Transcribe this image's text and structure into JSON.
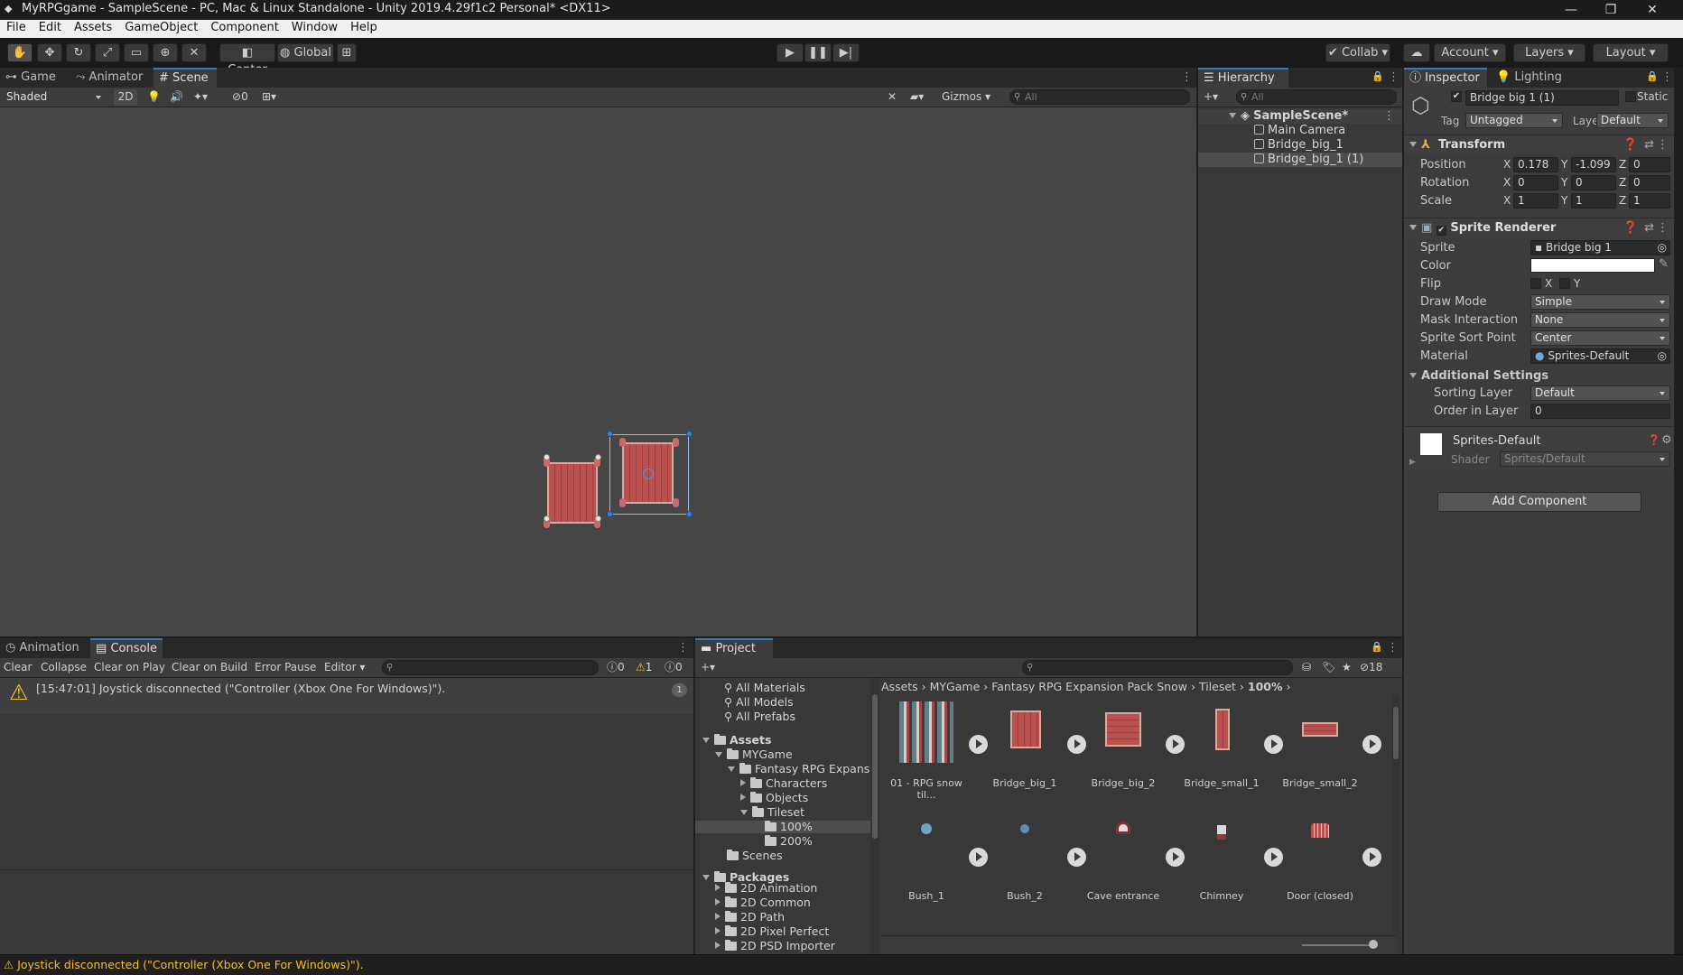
{
  "window": {
    "title": "MyRPGgame - SampleScene - PC, Mac & Linux Standalone - Unity 2019.4.29f1c2 Personal* <DX11>",
    "minimize": "—",
    "maximize": "❐",
    "close": "✕"
  },
  "menu": [
    "File",
    "Edit",
    "Assets",
    "GameObject",
    "Component",
    "Window",
    "Help"
  ],
  "toolbar": {
    "pivot": "Center",
    "space": "Global",
    "collab": "Collab",
    "account": "Account",
    "layers": "Layers",
    "layout": "Layout"
  },
  "scene_panel": {
    "tabs": [
      "Game",
      "Animator",
      "Scene"
    ],
    "shading": "Shaded",
    "mode_2d": "2D",
    "hidden_count": "0",
    "gizmos": "Gizmos",
    "search_placeholder": "All"
  },
  "hierarchy": {
    "tab": "Hierarchy",
    "search_placeholder": "All",
    "scene": "SampleScene*",
    "items": [
      "Main Camera",
      "Bridge_big_1",
      "Bridge_big_1 (1)"
    ]
  },
  "inspector": {
    "tabs": [
      "Inspector",
      "Lighting"
    ],
    "object_name": "Bridge big 1 (1)",
    "static_label": "Static",
    "tag_label": "Tag",
    "tag_value": "Untagged",
    "layer_label": "Layer",
    "layer_value": "Default",
    "transform": {
      "title": "Transform",
      "position_label": "Position",
      "rotation_label": "Rotation",
      "scale_label": "Scale",
      "axis_x": "X",
      "axis_y": "Y",
      "axis_z": "Z",
      "position": [
        "0.178",
        "-1.099",
        "0"
      ],
      "rotation": [
        "0",
        "0",
        "0"
      ],
      "scale": [
        "1",
        "1",
        "1"
      ]
    },
    "sprite_renderer": {
      "title": "Sprite Renderer",
      "sprite_label": "Sprite",
      "sprite_value": "Bridge big 1",
      "color_label": "Color",
      "flip_label": "Flip",
      "flip_x": "X",
      "flip_y": "Y",
      "draw_mode_label": "Draw Mode",
      "draw_mode": "Simple",
      "mask_label": "Mask Interaction",
      "mask": "None",
      "sort_point_label": "Sprite Sort Point",
      "sort_point": "Center",
      "material_label": "Material",
      "material": "Sprites-Default",
      "additional_label": "Additional Settings",
      "sorting_layer_label": "Sorting Layer",
      "sorting_layer": "Default",
      "order_label": "Order in Layer",
      "order": "0"
    },
    "material_block": {
      "name": "Sprites-Default",
      "shader_label": "Shader",
      "shader": "Sprites/Default"
    },
    "add_component": "Add Component"
  },
  "console": {
    "tabs": [
      "Animation",
      "Console"
    ],
    "buttons": [
      "Clear",
      "Collapse",
      "Clear on Play",
      "Clear on Build",
      "Error Pause",
      "Editor"
    ],
    "count_info": "0",
    "count_warn": "1",
    "count_error": "0",
    "message": "[15:47:01] Joystick disconnected (\"Controller (Xbox One For Windows)\").",
    "message_count": "1"
  },
  "project": {
    "tab": "Project",
    "hidden_count": "18",
    "favorites": [
      "All Materials",
      "All Models",
      "All Prefabs"
    ],
    "tree": [
      {
        "label": "Assets",
        "indent": 0,
        "arrow": "down",
        "bold": true
      },
      {
        "label": "MYGame",
        "indent": 1,
        "arrow": "down"
      },
      {
        "label": "Fantasy RPG Expansion",
        "indent": 2,
        "arrow": "down"
      },
      {
        "label": "Characters",
        "indent": 3,
        "arrow": "right"
      },
      {
        "label": "Objects",
        "indent": 3,
        "arrow": "right"
      },
      {
        "label": "Tileset",
        "indent": 3,
        "arrow": "down"
      },
      {
        "label": "100%",
        "indent": 4,
        "arrow": "none",
        "selected": true
      },
      {
        "label": "200%",
        "indent": 4,
        "arrow": "none"
      },
      {
        "label": "Scenes",
        "indent": 1,
        "arrow": "none"
      },
      {
        "label": "Packages",
        "indent": 0,
        "arrow": "down",
        "bold": true
      },
      {
        "label": "2D Animation",
        "indent": 1,
        "arrow": "right"
      },
      {
        "label": "2D Common",
        "indent": 1,
        "arrow": "right"
      },
      {
        "label": "2D Path",
        "indent": 1,
        "arrow": "right"
      },
      {
        "label": "2D Pixel Perfect",
        "indent": 1,
        "arrow": "right"
      },
      {
        "label": "2D PSD Importer",
        "indent": 1,
        "arrow": "right"
      }
    ],
    "breadcrumb": [
      "Assets",
      "MYGame",
      "Fantasy RPG Expansion Pack Snow",
      "Tileset",
      "100%"
    ],
    "assets_row1": [
      "01 - RPG snow til...",
      "Bridge_big_1",
      "Bridge_big_2",
      "Bridge_small_1",
      "Bridge_small_2"
    ],
    "assets_row2": [
      "Bush_1",
      "Bush_2",
      "Cave entrance",
      "Chimney",
      "Door (closed)"
    ]
  },
  "status_bar": {
    "message": "Joystick disconnected (\"Controller (Xbox One For Windows)\")."
  },
  "colors": {
    "accent": "#3a79bb",
    "selection": "#2c5d87",
    "bridge": "#b9514f",
    "warning": "#f2c12e"
  }
}
